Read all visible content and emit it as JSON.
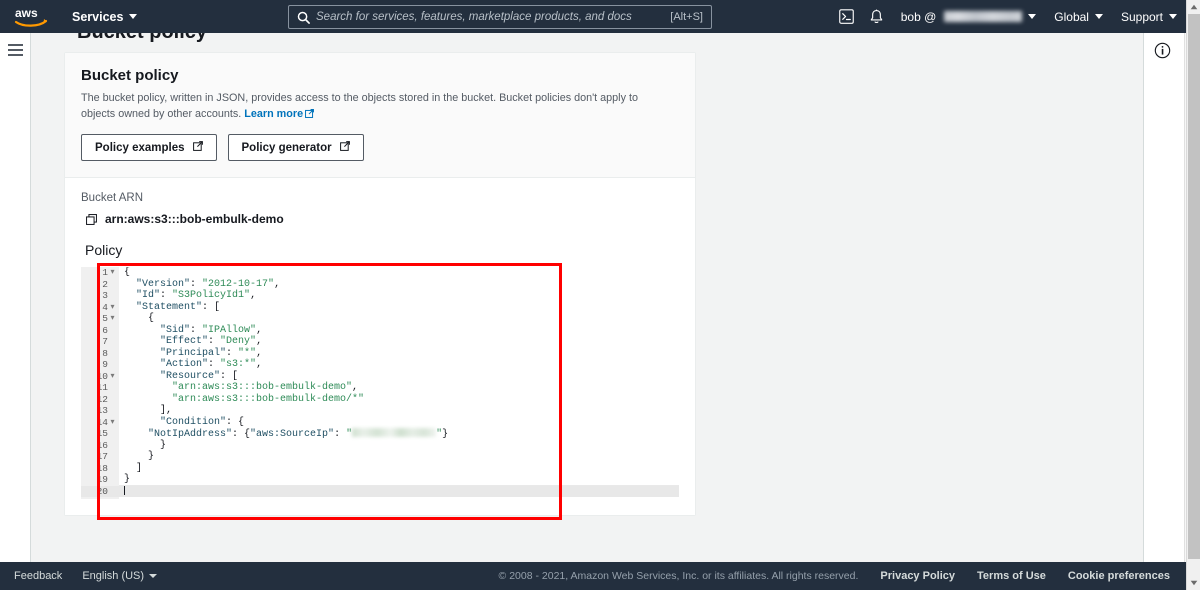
{
  "topnav": {
    "logo_name": "aws-logo",
    "services_label": "Services",
    "search": {
      "placeholder": "Search for services, features, marketplace products, and docs",
      "value": "",
      "shortcut": "[Alt+S]"
    },
    "cloudshell_icon": "cloudshell-icon",
    "bell_icon": "notifications-bell-icon",
    "account_label": "bob @",
    "account_redacted": true,
    "region_label": "Global",
    "support_label": "Support"
  },
  "page": {
    "title_cut": "Bucket policy"
  },
  "card": {
    "title": "Bucket policy",
    "description_part1": "The bucket policy, written in JSON, provides access to the objects stored in the bucket. Bucket policies don't apply to objects owned by other accounts.",
    "learn_more_label": "Learn more",
    "buttons": [
      {
        "label": "Policy examples",
        "icon": "external-link-icon"
      },
      {
        "label": "Policy generator",
        "icon": "external-link-icon"
      }
    ],
    "bucket_arn_label": "Bucket ARN",
    "bucket_arn_value": "arn:aws:s3:::bob-embulk-demo",
    "copy_icon": "copy-icon",
    "policy_label": "Policy"
  },
  "editor": {
    "active_line": 20,
    "lines": [
      {
        "n": "1",
        "fold": "▾",
        "indent": 0,
        "tokens": [
          {
            "t": "punct",
            "v": "{"
          }
        ]
      },
      {
        "n": "2",
        "fold": "",
        "indent": 1,
        "tokens": [
          {
            "t": "key",
            "v": "\"Version\""
          },
          {
            "t": "punct",
            "v": ": "
          },
          {
            "t": "str",
            "v": "\"2012-10-17\""
          },
          {
            "t": "punct",
            "v": ","
          }
        ]
      },
      {
        "n": "3",
        "fold": "",
        "indent": 1,
        "tokens": [
          {
            "t": "key",
            "v": "\"Id\""
          },
          {
            "t": "punct",
            "v": ": "
          },
          {
            "t": "str",
            "v": "\"S3PolicyId1\""
          },
          {
            "t": "punct",
            "v": ","
          }
        ]
      },
      {
        "n": "4",
        "fold": "▾",
        "indent": 1,
        "tokens": [
          {
            "t": "key",
            "v": "\"Statement\""
          },
          {
            "t": "punct",
            "v": ": ["
          }
        ]
      },
      {
        "n": "5",
        "fold": "▾",
        "indent": 2,
        "tokens": [
          {
            "t": "punct",
            "v": "{"
          }
        ]
      },
      {
        "n": "6",
        "fold": "",
        "indent": 3,
        "tokens": [
          {
            "t": "key",
            "v": "\"Sid\""
          },
          {
            "t": "punct",
            "v": ": "
          },
          {
            "t": "str",
            "v": "\"IPAllow\""
          },
          {
            "t": "punct",
            "v": ","
          }
        ]
      },
      {
        "n": "7",
        "fold": "",
        "indent": 3,
        "tokens": [
          {
            "t": "key",
            "v": "\"Effect\""
          },
          {
            "t": "punct",
            "v": ": "
          },
          {
            "t": "str",
            "v": "\"Deny\""
          },
          {
            "t": "punct",
            "v": ","
          }
        ]
      },
      {
        "n": "8",
        "fold": "",
        "indent": 3,
        "tokens": [
          {
            "t": "key",
            "v": "\"Principal\""
          },
          {
            "t": "punct",
            "v": ": "
          },
          {
            "t": "str",
            "v": "\"*\""
          },
          {
            "t": "punct",
            "v": ","
          }
        ]
      },
      {
        "n": "9",
        "fold": "",
        "indent": 3,
        "tokens": [
          {
            "t": "key",
            "v": "\"Action\""
          },
          {
            "t": "punct",
            "v": ": "
          },
          {
            "t": "str",
            "v": "\"s3:*\""
          },
          {
            "t": "punct",
            "v": ","
          }
        ]
      },
      {
        "n": "10",
        "fold": "▾",
        "indent": 3,
        "tokens": [
          {
            "t": "key",
            "v": "\"Resource\""
          },
          {
            "t": "punct",
            "v": ": ["
          }
        ]
      },
      {
        "n": "11",
        "fold": "",
        "indent": 4,
        "tokens": [
          {
            "t": "str",
            "v": "\"arn:aws:s3:::bob-embulk-demo\""
          },
          {
            "t": "punct",
            "v": ","
          }
        ]
      },
      {
        "n": "12",
        "fold": "",
        "indent": 4,
        "tokens": [
          {
            "t": "str",
            "v": "\"arn:aws:s3:::bob-embulk-demo/*\""
          }
        ]
      },
      {
        "n": "13",
        "fold": "",
        "indent": 3,
        "tokens": [
          {
            "t": "punct",
            "v": "],"
          }
        ]
      },
      {
        "n": "14",
        "fold": "▾",
        "indent": 3,
        "tokens": [
          {
            "t": "key",
            "v": "\"Condition\""
          },
          {
            "t": "punct",
            "v": ": {"
          }
        ]
      },
      {
        "n": "15",
        "fold": "",
        "indent": 2,
        "tokens": [
          {
            "t": "key",
            "v": "\"NotIpAddress\""
          },
          {
            "t": "punct",
            "v": ": {"
          },
          {
            "t": "key",
            "v": "\"aws:SourceIp\""
          },
          {
            "t": "punct",
            "v": ": "
          },
          {
            "t": "str",
            "v": "\""
          },
          {
            "t": "redact",
            "v": ""
          },
          {
            "t": "str",
            "v": "\""
          },
          {
            "t": "punct",
            "v": "}"
          }
        ]
      },
      {
        "n": "16",
        "fold": "",
        "indent": 3,
        "tokens": [
          {
            "t": "punct",
            "v": "}"
          }
        ]
      },
      {
        "n": "17",
        "fold": "",
        "indent": 2,
        "tokens": [
          {
            "t": "punct",
            "v": "}"
          }
        ]
      },
      {
        "n": "18",
        "fold": "",
        "indent": 1,
        "tokens": [
          {
            "t": "punct",
            "v": "]"
          }
        ]
      },
      {
        "n": "19",
        "fold": "",
        "indent": 0,
        "tokens": [
          {
            "t": "punct",
            "v": "}"
          }
        ]
      },
      {
        "n": "20",
        "fold": "",
        "indent": 0,
        "tokens": [
          {
            "t": "caret",
            "v": ""
          }
        ]
      }
    ]
  },
  "footer": {
    "feedback_label": "Feedback",
    "language_label": "English (US)",
    "copyright": "© 2008 - 2021, Amazon Web Services, Inc. or its affiliates. All rights reserved.",
    "links": [
      "Privacy Policy",
      "Terms of Use",
      "Cookie preferences"
    ]
  },
  "colors": {
    "nav_bg": "#232f3e",
    "link": "#0073bb",
    "highlight_box": "#ff0000",
    "code_key": "#1f4f63",
    "code_string": "#2e8b57"
  }
}
